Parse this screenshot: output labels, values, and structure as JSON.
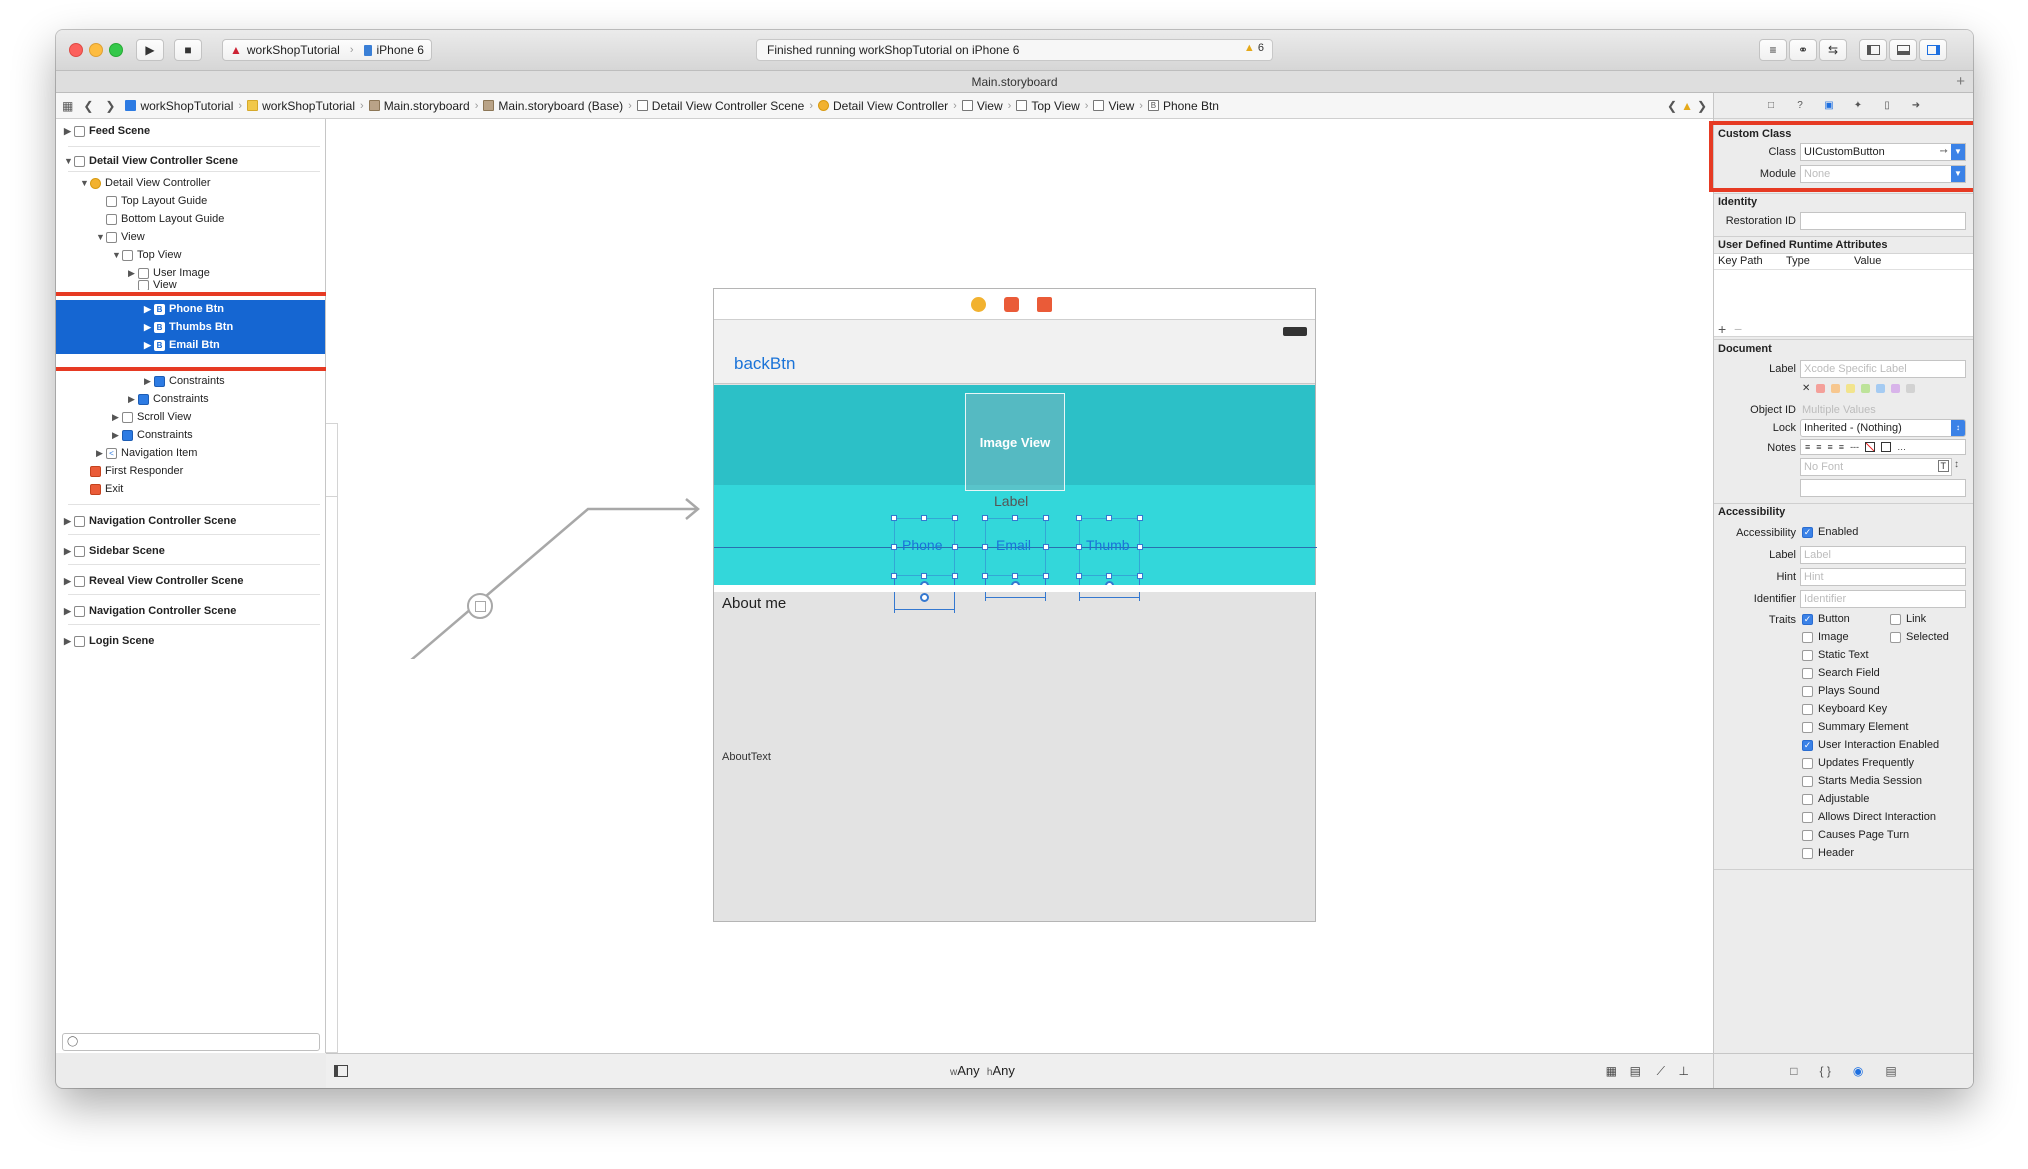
{
  "toolbar": {
    "scheme_target": "workShopTutorial",
    "device": "iPhone 6",
    "status_message": "Finished running workShopTutorial on iPhone 6",
    "warning_count": "6",
    "run_icon": "play-icon",
    "stop_icon": "stop-icon"
  },
  "tab_title": "Main.storyboard",
  "breadcrumbs": [
    "workShopTutorial",
    "workShopTutorial",
    "Main.storyboard",
    "Main.storyboard (Base)",
    "Detail View Controller Scene",
    "Detail View Controller",
    "View",
    "Top View",
    "View",
    "Phone Btn"
  ],
  "outline": {
    "feed_scene": "Feed Scene",
    "detail_scene": "Detail View Controller Scene",
    "detail_vc": "Detail View Controller",
    "top_layout": "Top Layout Guide",
    "bottom_layout": "Bottom Layout Guide",
    "view": "View",
    "top_view": "Top View",
    "user_image": "User Image",
    "inner_view": "View",
    "phone_btn": "Phone Btn",
    "thumbs_btn": "Thumbs Btn",
    "email_btn": "Email Btn",
    "constraints_inner": "Constraints",
    "constraints_top": "Constraints",
    "scroll_view": "Scroll View",
    "constraints_view": "Constraints",
    "navigation_item": "Navigation Item",
    "first_responder": "First Responder",
    "exit": "Exit",
    "nav_scene_1": "Navigation Controller Scene",
    "sidebar_scene": "Sidebar Scene",
    "reveal_scene": "Reveal View Controller Scene",
    "nav_scene_2": "Navigation Controller Scene",
    "login_scene": "Login Scene"
  },
  "canvas": {
    "back_button": "backBtn",
    "image_view": "Image View",
    "label": "Label",
    "phone": "Phone",
    "email": "Email",
    "thumb": "Thumb",
    "about_me": "About me",
    "about_text": "AboutText"
  },
  "size_class": {
    "w_prefix": "w",
    "w_value": "Any",
    "h_prefix": "h",
    "h_value": "Any"
  },
  "inspector": {
    "custom_class": {
      "title": "Custom Class",
      "class_label": "Class",
      "class_value": "UICustomButton",
      "module_label": "Module",
      "module_placeholder": "None"
    },
    "identity": {
      "title": "Identity",
      "restoration_label": "Restoration ID"
    },
    "runtime": {
      "title": "User Defined Runtime Attributes",
      "col_keypath": "Key Path",
      "col_type": "Type",
      "col_value": "Value",
      "add": "+",
      "remove": "−"
    },
    "document": {
      "title": "Document",
      "label_label": "Label",
      "label_placeholder": "Xcode Specific Label",
      "objectid_label": "Object ID",
      "objectid_value": "Multiple Values",
      "lock_label": "Lock",
      "lock_value": "Inherited - (Nothing)",
      "notes_label": "Notes",
      "font_placeholder": "No Font"
    },
    "accessibility": {
      "title": "Accessibility",
      "access_label": "Accessibility",
      "enabled": "Enabled",
      "label_label": "Label",
      "label_placeholder": "Label",
      "hint_label": "Hint",
      "hint_placeholder": "Hint",
      "identifier_label": "Identifier",
      "identifier_placeholder": "Identifier",
      "traits_label": "Traits",
      "traits": {
        "button": "Button",
        "link": "Link",
        "image": "Image",
        "selected": "Selected",
        "static_text": "Static Text",
        "search_field": "Search Field",
        "plays_sound": "Plays Sound",
        "keyboard_key": "Keyboard Key",
        "summary_element": "Summary Element",
        "user_interaction": "User Interaction Enabled",
        "updates_frequently": "Updates Frequently",
        "starts_media": "Starts Media Session",
        "adjustable": "Adjustable",
        "allows_direct": "Allows Direct Interaction",
        "causes_page_turn": "Causes Page Turn",
        "header": "Header"
      }
    }
  },
  "colors": {
    "selection": "#1566d2",
    "highlight_box": "#e63a23",
    "teal_dark": "#2cc0c7",
    "teal_light": "#33d7da",
    "button_text": "#1a73d8"
  }
}
